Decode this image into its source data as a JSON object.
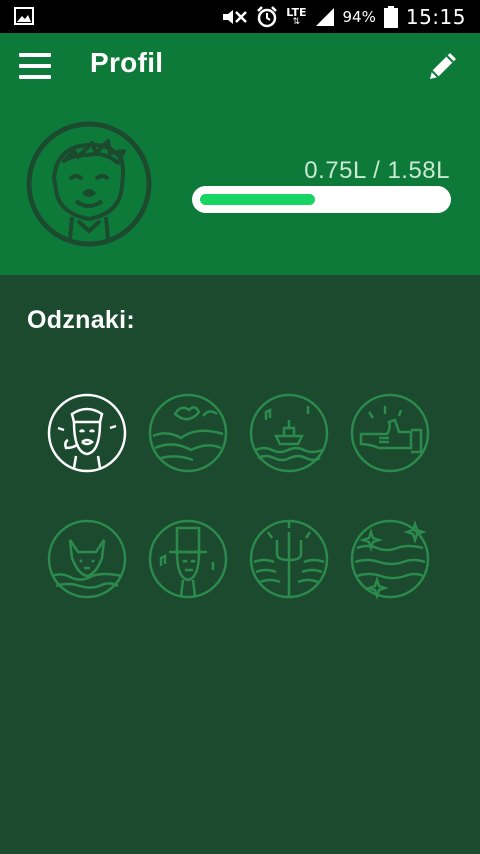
{
  "status_bar": {
    "battery_percent": "94%",
    "network_label": "LTE",
    "time": "15:15",
    "icons": [
      "gallery-icon",
      "mute-icon",
      "alarm-icon",
      "lte-icon",
      "signal-icon",
      "battery-icon"
    ]
  },
  "header": {
    "title": "Profil",
    "menu_icon": "hamburger-menu-icon",
    "edit_icon": "pencil-icon",
    "avatar_icon": "user-face-icon",
    "background": "#0e7a3a"
  },
  "progress": {
    "current": 0.75,
    "goal": 1.58,
    "text": "0.75L / 1.58L",
    "fill_color": "#18d463"
  },
  "badges": {
    "title": "Odznaki:",
    "items": [
      {
        "name": "sailor-captain-badge",
        "unlocked": true
      },
      {
        "name": "bird-landscape-badge",
        "unlocked": false
      },
      {
        "name": "boat-music-badge",
        "unlocked": false
      },
      {
        "name": "hand-thumbs-badge",
        "unlocked": false
      },
      {
        "name": "fox-water-badge",
        "unlocked": false
      },
      {
        "name": "top-hat-man-badge",
        "unlocked": false
      },
      {
        "name": "trident-badge",
        "unlocked": false
      },
      {
        "name": "sparkle-waves-badge",
        "unlocked": false
      }
    ]
  },
  "colors": {
    "page_background": "#1b4a2f",
    "locked_badge": "#2c8a4c",
    "unlocked_badge": "#ffffff"
  }
}
